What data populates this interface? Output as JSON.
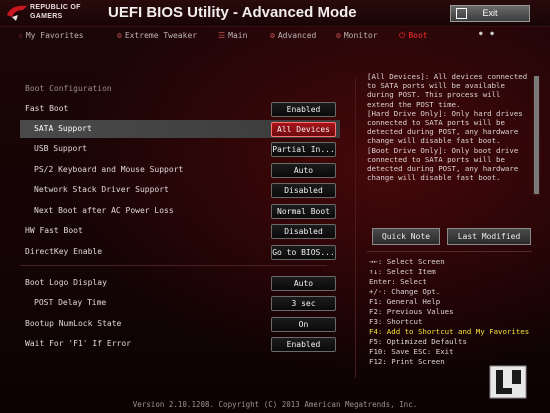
{
  "header": {
    "brand_line1": "REPUBLIC OF",
    "brand_line2": "GAMERS",
    "title": "UEFI BIOS Utility - Advanced Mode",
    "exit_label": "Exit"
  },
  "tabs": [
    {
      "label": "My Favorites",
      "icon": "star-icon"
    },
    {
      "label": "Extreme Tweaker",
      "icon": "tweak-icon"
    },
    {
      "label": "Main",
      "icon": "main-icon"
    },
    {
      "label": "Advanced",
      "icon": "advanced-icon"
    },
    {
      "label": "Monitor",
      "icon": "monitor-icon"
    },
    {
      "label": "Boot",
      "icon": "power-icon",
      "active": true
    }
  ],
  "settings": {
    "section_title": "Boot Configuration",
    "rows": [
      {
        "label": "Fast Boot",
        "value": "Enabled"
      },
      {
        "label": "SATA Support",
        "value": "All Devices"
      },
      {
        "label": "USB Support",
        "value": "Partial In..."
      },
      {
        "label": "PS/2 Keyboard and Mouse Support",
        "value": "Auto"
      },
      {
        "label": "Network Stack Driver Support",
        "value": "Disabled"
      },
      {
        "label": "Next Boot after AC Power Loss",
        "value": "Normal Boot"
      },
      {
        "label": "HW Fast Boot",
        "value": "Disabled"
      },
      {
        "label": "DirectKey Enable",
        "value": "Go to BIOS..."
      },
      {
        "label": "Boot Logo Display",
        "value": "Auto"
      },
      {
        "label": "POST Delay Time",
        "value": "3 sec"
      },
      {
        "label": "Bootup NumLock State",
        "value": "On"
      },
      {
        "label": "Wait For 'F1' If Error",
        "value": "Enabled"
      }
    ]
  },
  "help_text": [
    "[All Devices]: All devices connected",
    "to SATA ports will be available",
    "during POST. This process will",
    "extend the POST time.",
    "[Hard Drive Only]: Only hard drives",
    "connected to SATA ports will be",
    "detected during POST, any hardware",
    "change will disable fast boot.",
    "[Boot Drive Only]: Only boot drive",
    "connected to SATA ports will be",
    "detected during POST, any hardware",
    "change will disable fast boot."
  ],
  "buttons": {
    "quick_note": "Quick Note",
    "last_modified": "Last Modified"
  },
  "key_help": [
    "→←: Select Screen",
    "↑↓: Select Item",
    "Enter: Select",
    "+/-: Change Opt.",
    "F1: General Help",
    "F2: Previous Values",
    "F3: Shortcut",
    "F4: Add to Shortcut and My Favorites",
    "F5: Optimized Defaults",
    "F10: Save  ESC: Exit",
    "F12: Print Screen"
  ],
  "footer": "Version 2.10.1208. Copyright (C) 2013 American Megatrends, Inc.",
  "colors": {
    "accent": "#ff2c2c",
    "selected_value": "#a8141a",
    "highlight_key": "#f4e23a"
  }
}
